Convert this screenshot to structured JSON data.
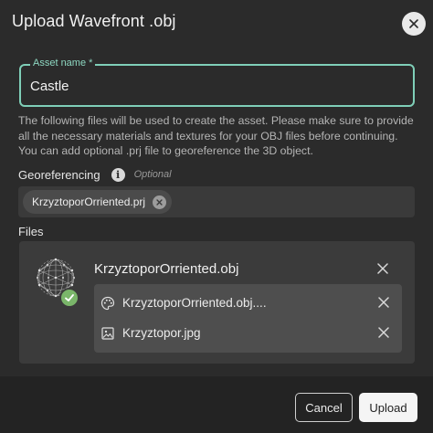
{
  "dialog": {
    "title": "Upload Wavefront .obj"
  },
  "asset_name": {
    "label": "Asset name *",
    "value": "Castle"
  },
  "help_text": {
    "line1": "The following files will be used to create the asset. Please make sure to provide all the necessary materials and textures for your OBJ files before continuing.",
    "line2": "You can add optional .prj file to georeference the 3D object."
  },
  "georeferencing": {
    "label": "Georeferencing",
    "info_icon": "info-icon",
    "optional_label": "Optional",
    "file_chip": "KrzyztoporOrriented.prj"
  },
  "files": {
    "label": "Files",
    "main_file": "KrzyztoporOrriented.obj",
    "main_icon": "mesh-sphere-icon",
    "status": "check-icon",
    "items": [
      {
        "icon": "palette-icon",
        "name": "KrzyztoporOrriented.obj...."
      },
      {
        "icon": "image-icon",
        "name": "Krzyztopor.jpg"
      }
    ]
  },
  "footer": {
    "cancel_label": "Cancel",
    "upload_label": "Upload"
  },
  "colors": {
    "accent": "#7fcfb8",
    "success": "#7ab66a",
    "background": "#2b2b2b",
    "panel": "#3b3b3b"
  }
}
